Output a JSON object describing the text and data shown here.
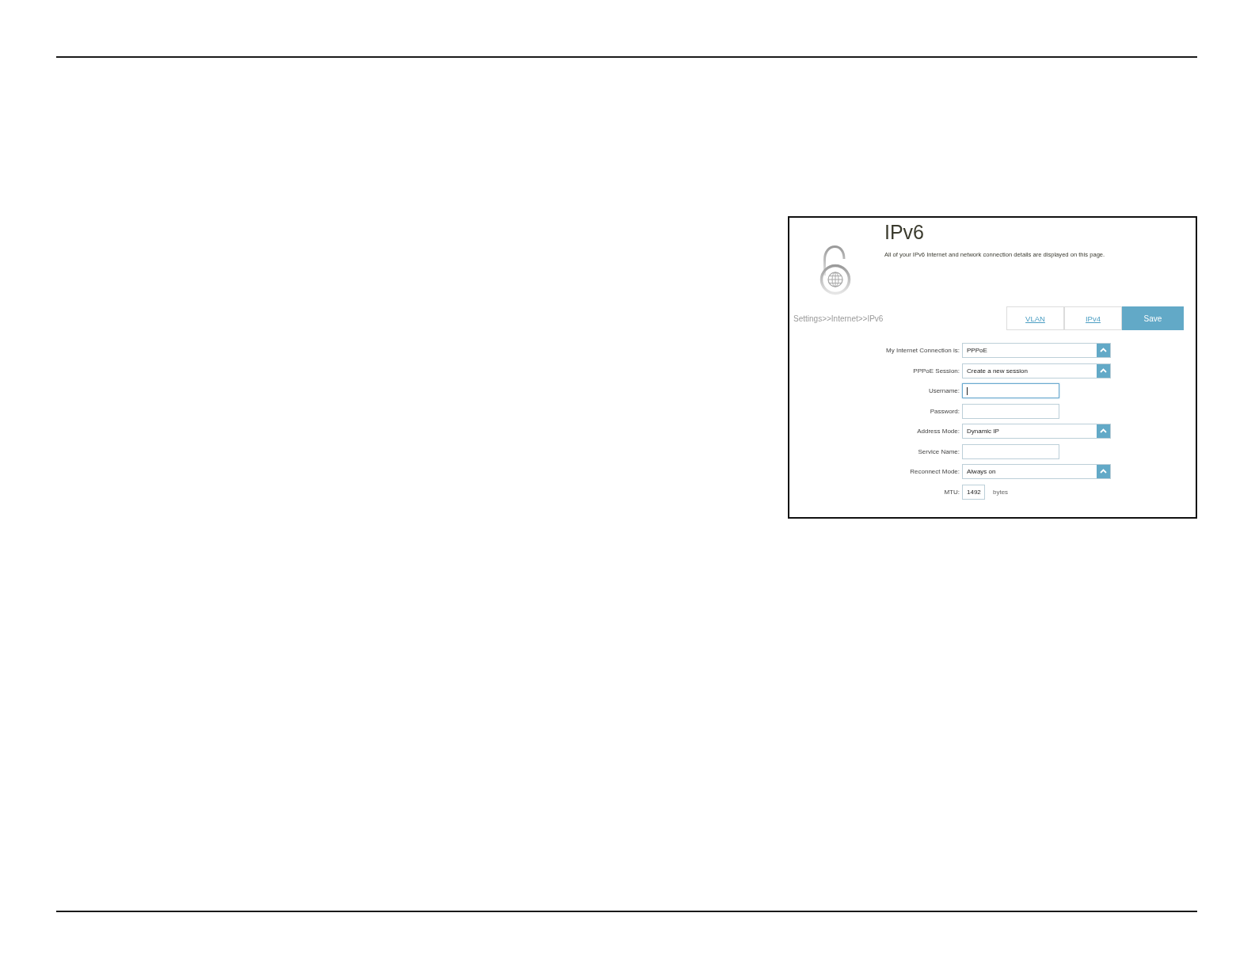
{
  "settings_window": {
    "title": "IPv6",
    "description": "All of your IPv6 Internet and network connection details are displayed on this page.",
    "breadcrumb": "Settings>>Internet>>IPv6",
    "buttons": [
      {
        "label": "VLAN",
        "kind": "link"
      },
      {
        "label": "IPv4",
        "kind": "link"
      },
      {
        "label": "Save",
        "kind": "primary"
      }
    ],
    "fields": [
      {
        "label": "My Internet Connection is:",
        "kind": "select",
        "value": "PPPoE",
        "focused": false
      },
      {
        "label": "PPPoE Session:",
        "kind": "select",
        "value": "Create a new session",
        "focused": false
      },
      {
        "label": "Username:",
        "kind": "text",
        "focused": true
      },
      {
        "label": "Password:",
        "kind": "text",
        "focused": false
      },
      {
        "label": "Address Mode:",
        "kind": "select",
        "value": "Dynamic IP",
        "focused": false
      },
      {
        "label": "Service Name:",
        "kind": "text",
        "focused": false
      },
      {
        "label": "Reconnect Mode:",
        "kind": "select",
        "value": "Always on",
        "focused": false
      },
      {
        "label": "MTU:",
        "kind": "number",
        "value": "1492",
        "unit": "bytes",
        "focused": false
      }
    ]
  }
}
